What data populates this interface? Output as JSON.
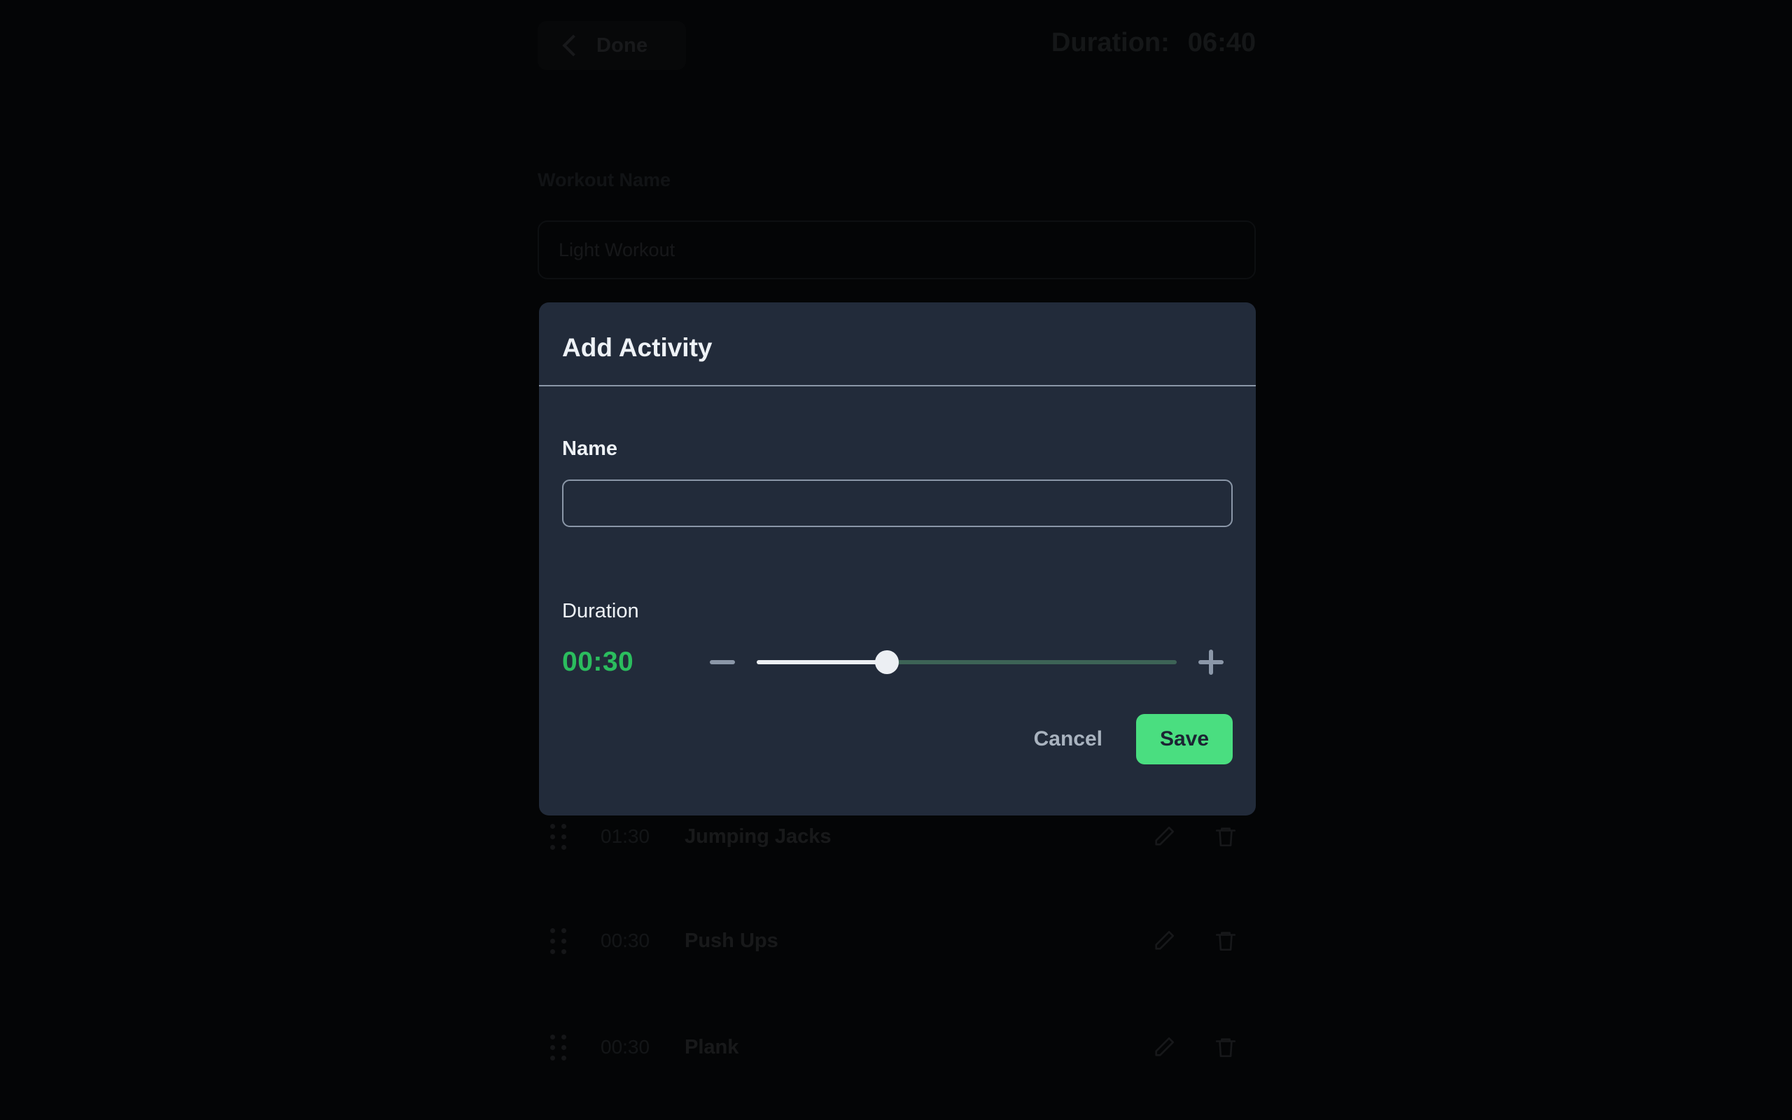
{
  "colors": {
    "page_background": "#040506",
    "modal_background": "#222b3a",
    "accent_green": "#4ade80",
    "duration_green": "#2bbd5e",
    "slider_fill": "#eceff3",
    "slider_remaining": "#3d6356",
    "muted_text": "#8b97a8"
  },
  "header": {
    "done_button": {
      "label": "Done",
      "icon": "chevron-left-icon"
    },
    "duration_label": "Duration:",
    "duration_value": "06:40"
  },
  "workout": {
    "name_label": "Workout Name",
    "name_value": "Light Workout",
    "name_placeholder": "Workout Name"
  },
  "activities": [
    {
      "time": "01:30",
      "name": "Jumping Jacks",
      "edit_icon": "pencil-icon",
      "delete_icon": "trash-icon",
      "drag_icon": "drag-handle-icon"
    },
    {
      "time": "00:30",
      "name": "Push Ups",
      "edit_icon": "pencil-icon",
      "delete_icon": "trash-icon",
      "drag_icon": "drag-handle-icon"
    },
    {
      "time": "00:30",
      "name": "Plank",
      "edit_icon": "pencil-icon",
      "delete_icon": "trash-icon",
      "drag_icon": "drag-handle-icon"
    }
  ],
  "modal": {
    "title": "Add Activity",
    "name_label": "Name",
    "name_value": "",
    "name_placeholder": "",
    "duration_label": "Duration",
    "duration_value": "00:30",
    "slider": {
      "percent": 31,
      "decrement_icon": "minus-icon",
      "increment_icon": "plus-icon"
    },
    "cancel_label": "Cancel",
    "save_label": "Save"
  }
}
